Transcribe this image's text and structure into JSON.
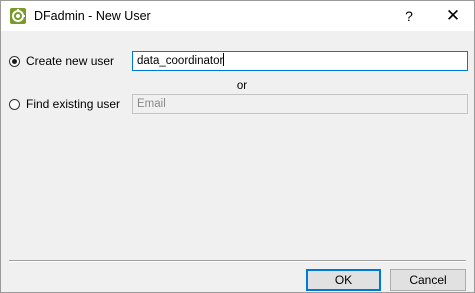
{
  "window": {
    "title": "DFadmin - New User",
    "help_label": "?",
    "close_label": "✕",
    "app_icon": "gear-icon"
  },
  "form": {
    "create_option": {
      "label": "Create new user",
      "selected": true,
      "value": "data_coordinator"
    },
    "separator_text": "or",
    "find_option": {
      "label": "Find existing user",
      "selected": false,
      "value": "",
      "placeholder": "Email"
    }
  },
  "buttons": {
    "ok_label": "OK",
    "cancel_label": "Cancel"
  },
  "colors": {
    "focus_accent": "#0078d7",
    "dialog_background": "#f0f0f0",
    "titlebar_background": "#ffffff"
  }
}
